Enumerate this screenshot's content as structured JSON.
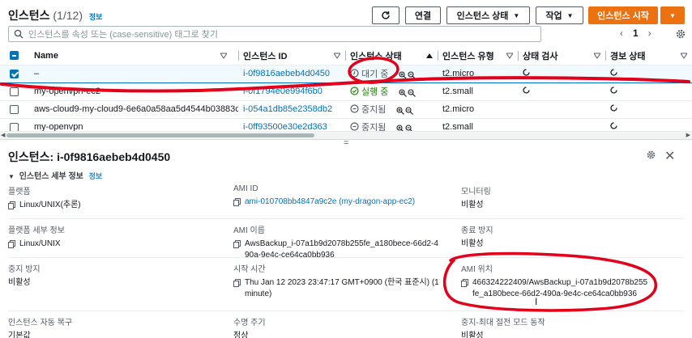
{
  "header": {
    "title": "인스턴스",
    "count": "(1/12)",
    "info": "정보",
    "refresh_icon": "refresh-icon",
    "connect_label": "연결",
    "instance_state_label": "인스턴스 상태",
    "actions_label": "작업",
    "launch_label": "인스턴스 시작"
  },
  "search": {
    "placeholder": "인스턴스를 속성 또는 (case-sensitive) 태그로 찾기"
  },
  "pager": {
    "prev": "‹",
    "page": "1",
    "next": "›"
  },
  "table": {
    "columns": [
      "Name",
      "인스턴스 ID",
      "인스턴스 상태",
      "인스턴스 유형",
      "상태 검사",
      "경보 상태"
    ],
    "rows": [
      {
        "name": "–",
        "id": "i-0f9816aebeb4d0450",
        "state": "대기 중",
        "type": "t2.micro"
      },
      {
        "name": "my-openvpn-ec2",
        "id": "i-0f1794e0e994f6b0",
        "state": "실행 중",
        "type": "t2.small"
      },
      {
        "name": "aws-cloud9-my-cloud9-6e6a0a58aa5d4544b03883c...",
        "id": "i-054a1db85e2358db2",
        "state": "중지됨",
        "type": "t2.micro"
      },
      {
        "name": "my-openvpn",
        "id": "i-0ff93500e30e2d363",
        "state": "중지됨",
        "type": "t2.small"
      }
    ]
  },
  "divider": {
    "grip": "="
  },
  "details": {
    "title_prefix": "인스턴스: ",
    "title_id": "i-0f9816aebeb4d0450",
    "section": "인스턴스 세부 정보",
    "section_info": "정보",
    "fields": {
      "platform_label": "플랫폼",
      "platform_value": "Linux/UNIX(추론)",
      "ami_id_label": "AMI ID",
      "ami_id_value": "ami-010708bb4847a9c2e (my-dragon-app-ec2)",
      "monitoring_label": "모니터링",
      "monitoring_value": "비활성",
      "platform_detail_label": "플랫폼 세부 정보",
      "platform_detail_value": "Linux/UNIX",
      "ami_name_label": "AMI 이름",
      "ami_name_value": "AwsBackup_i-07a1b9d2078b255fe_a180bece-66d2-490a-9e4c-ce64ca0bb936",
      "termination_label": "종료 방지",
      "termination_value": "비활성",
      "stop_protection_label": "중지 방지",
      "stop_protection_value": "비활성",
      "launch_time_label": "시작 시간",
      "launch_time_value": "Thu Jan 12 2023 23:47:17 GMT+0900 (한국 표준시) (1 minute)",
      "ami_location_label": "AMI 위치",
      "ami_location_value": "466324222409/AwsBackup_i-07a1b9d2078b255fe_a180bece-66d2-490a-9e4c-ce64ca0bb936",
      "auto_recovery_label": "인스턴스 자동 복구",
      "auto_recovery_value": "기본값",
      "lifecycle_label": "수명 주기",
      "lifecycle_value": "정상",
      "stop_hibernate_label": "중지-최대 절전 모드 동작",
      "stop_hibernate_value": "비활성"
    }
  },
  "colors": {
    "link": "#0073bb",
    "primary": "#ec7211",
    "annotation": "#e3001b"
  }
}
